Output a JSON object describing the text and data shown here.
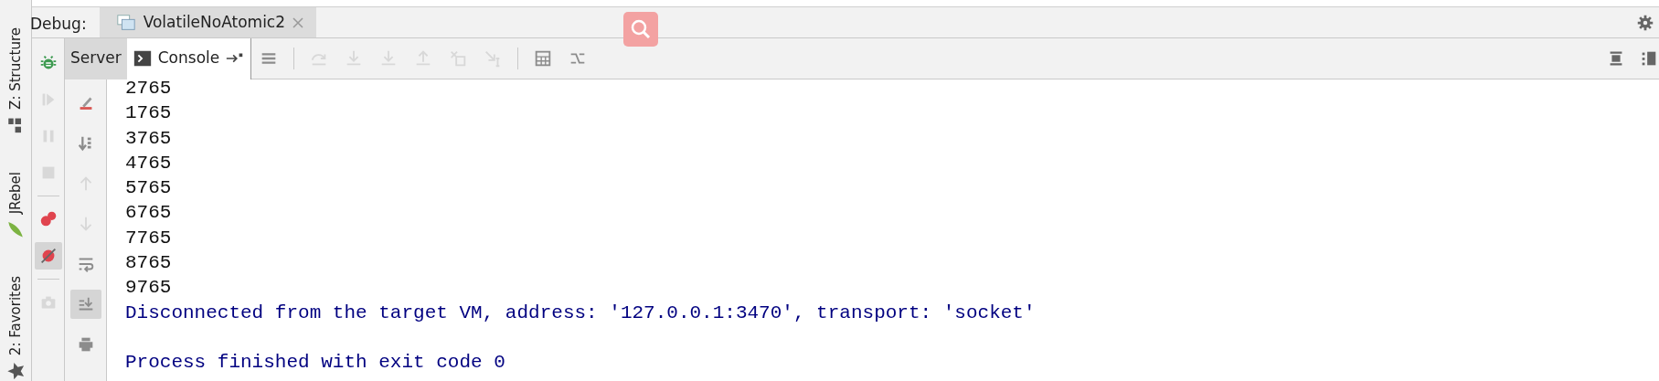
{
  "debug_bar": {
    "label": "Debug:",
    "tabs": [
      {
        "label": "VolatileNoAtomic2",
        "selected": true
      }
    ]
  },
  "side_tabs": [
    {
      "label": "Z: Structure"
    },
    {
      "label": "JRebel"
    },
    {
      "label": "2: Favorites"
    }
  ],
  "toolbar_tabs": [
    {
      "label": "Server",
      "selected": false
    },
    {
      "label": "Console",
      "selected": true
    }
  ],
  "top_tools": [
    {
      "disabled": false
    },
    {
      "disabled": true
    },
    {
      "disabled": true
    },
    {
      "disabled": true
    },
    {
      "disabled": true
    },
    {
      "disabled": true
    },
    {
      "disabled": true
    },
    {
      "disabled": false
    },
    {
      "disabled": false
    }
  ],
  "debug_tools": [
    {
      "disabled": false,
      "pressed": false
    },
    {
      "disabled": true,
      "pressed": false
    },
    {
      "disabled": true,
      "pressed": false
    },
    {
      "disabled": true,
      "pressed": false
    },
    {
      "disabled": false,
      "pressed": false
    },
    {
      "disabled": false,
      "pressed": true
    },
    {
      "disabled": true,
      "pressed": false
    }
  ],
  "console_tools": [
    {
      "disabled": false,
      "pressed": false
    },
    {
      "disabled": false,
      "pressed": false
    },
    {
      "disabled": true,
      "pressed": false
    },
    {
      "disabled": true,
      "pressed": false
    },
    {
      "disabled": false,
      "pressed": false
    },
    {
      "disabled": false,
      "pressed": true
    },
    {
      "disabled": false,
      "pressed": false
    }
  ],
  "console": {
    "lines": [
      {
        "kind": "output",
        "text": "2765"
      },
      {
        "kind": "output",
        "text": "1765"
      },
      {
        "kind": "output",
        "text": "3765"
      },
      {
        "kind": "output",
        "text": "4765"
      },
      {
        "kind": "output",
        "text": "5765"
      },
      {
        "kind": "output",
        "text": "6765"
      },
      {
        "kind": "output",
        "text": "7765"
      },
      {
        "kind": "output",
        "text": "8765"
      },
      {
        "kind": "output",
        "text": "9765"
      },
      {
        "kind": "system",
        "text": "Disconnected from the target VM, address: '127.0.0.1:3470', transport: 'socket'"
      },
      {
        "kind": "blank"
      },
      {
        "kind": "system",
        "text": "Process finished with exit code 0"
      }
    ]
  }
}
